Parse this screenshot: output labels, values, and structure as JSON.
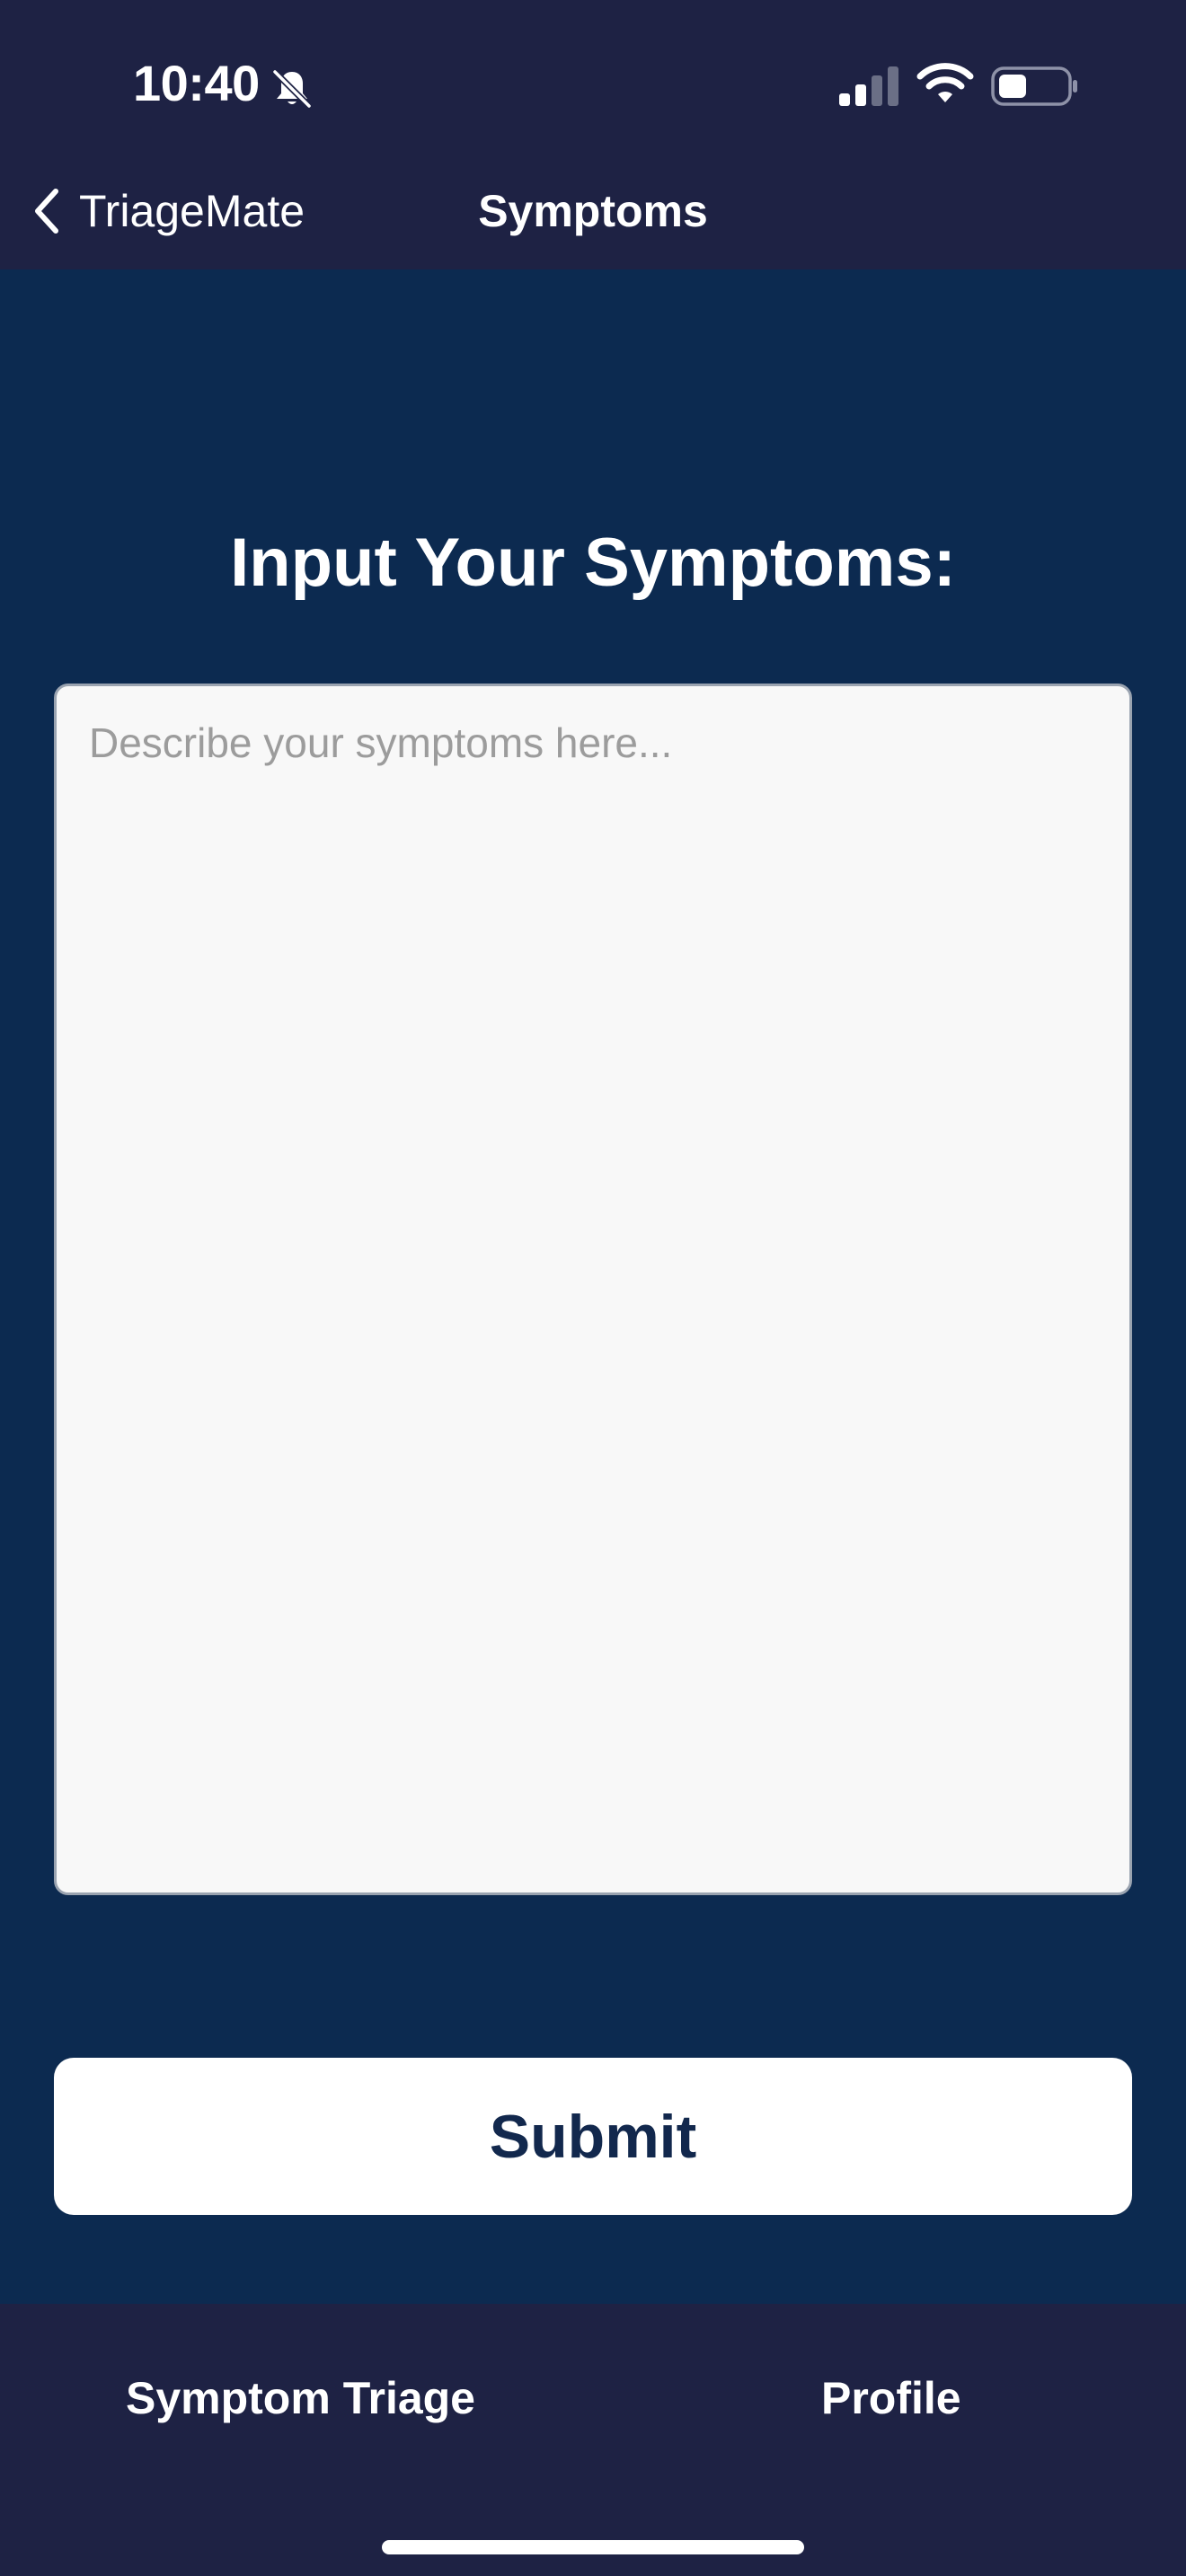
{
  "status_bar": {
    "time": "10:40",
    "icons": [
      "bell-slash-icon",
      "cellular-signal-icon",
      "wifi-icon",
      "battery-icon"
    ]
  },
  "nav": {
    "back_label": "TriageMate",
    "title": "Symptoms"
  },
  "main": {
    "heading": "Input Your Symptoms:",
    "textarea": {
      "placeholder": "Describe your symptoms here...",
      "value": ""
    },
    "submit_label": "Submit"
  },
  "tab_bar": {
    "tabs": [
      {
        "label": "Symptom Triage"
      },
      {
        "label": "Profile"
      }
    ]
  },
  "colors": {
    "chrome_bg": "#1e2244",
    "content_bg": "#0c2a50",
    "input_bg": "#f8f8f8",
    "submit_text": "#12284d"
  }
}
